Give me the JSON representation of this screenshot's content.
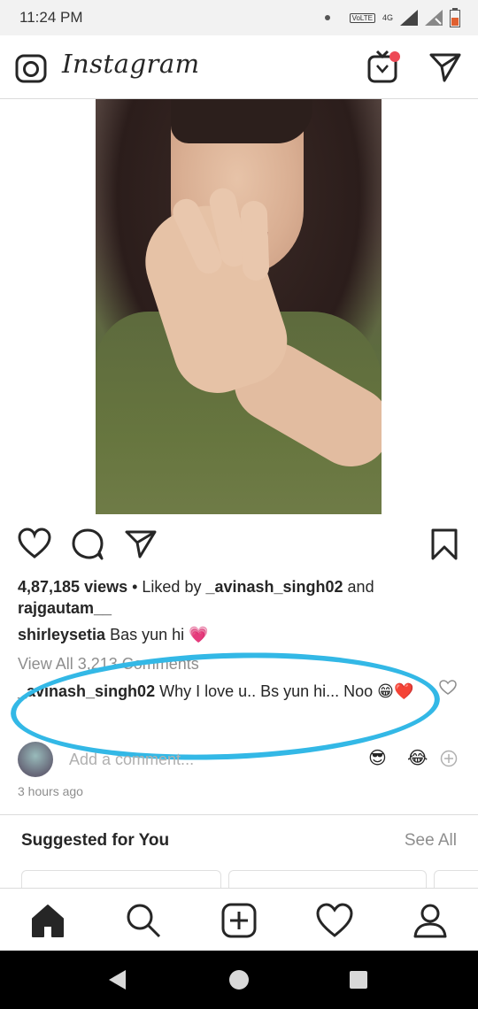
{
  "status_bar": {
    "time": "11:24 PM",
    "volte_label": "VoLTE",
    "network": "4G"
  },
  "app": {
    "name": "Instagram"
  },
  "post": {
    "views": "4,87,185 views",
    "liked_by_prefix": " • Liked by ",
    "liked_by_user1": "_avinash_singh02",
    "liked_by_and": " and",
    "liked_by_user2": "rajgautam__",
    "caption_user": "shirleysetia",
    "caption_text": " Bas yun hi 💗",
    "view_all_comments": "View All 3,213 Comments",
    "comment_user": "_avinash_singh02",
    "comment_text": " Why I love u.. Bs yun hi... Noo 😁❤️",
    "add_comment_placeholder": "Add a comment...",
    "quick_emojis": [
      "😎",
      "😂"
    ],
    "time_ago": "3 hours ago"
  },
  "suggested": {
    "title": "Suggested for You",
    "see_all": "See All"
  },
  "colors": {
    "highlight_circle": "#33b8e6",
    "notification_dot": "#ed4956",
    "heart_red": "#ed4956"
  }
}
